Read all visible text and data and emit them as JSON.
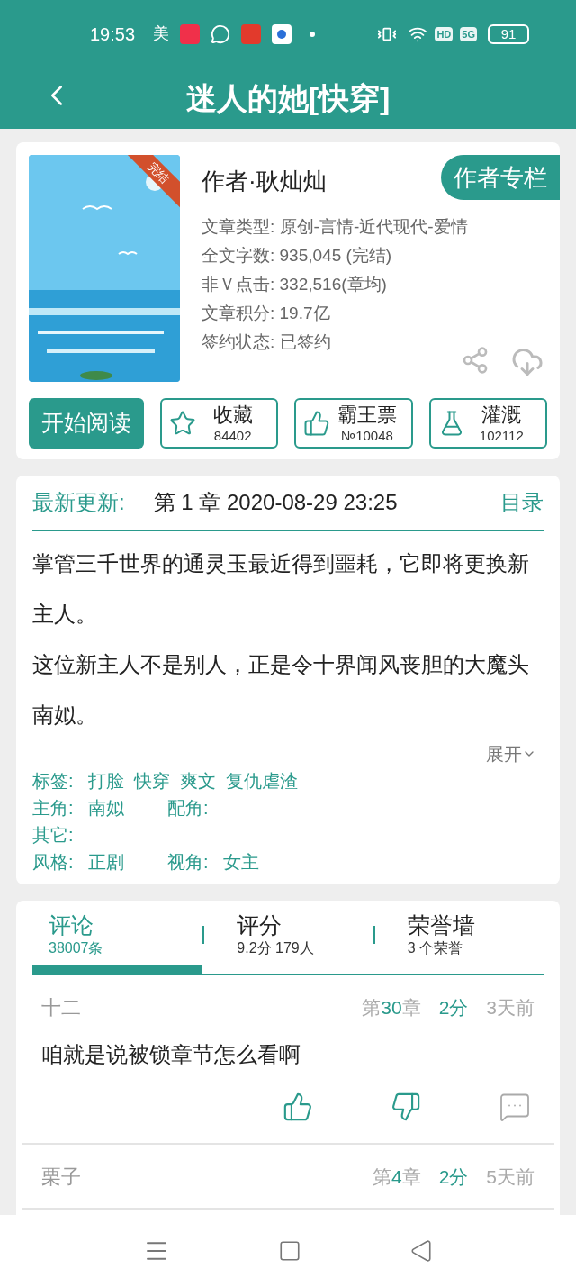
{
  "status_bar": {
    "time": "19:53",
    "notification": "美",
    "indicators": [
      "HD",
      "5G"
    ],
    "battery": "91"
  },
  "header": {
    "title": "迷人的她[快穿]"
  },
  "book": {
    "badge": "完结",
    "author": "作者·耿灿灿",
    "author_button": "作者专栏",
    "info": [
      "文章类型: 原创-言情-近代现代-爱情",
      "全文字数: 935,045 (完结)",
      "非Ｖ点击: 332,516(章均)",
      "文章积分: 19.7亿",
      "签约状态:  已签约"
    ],
    "read_button": "开始阅读",
    "stats": [
      {
        "kind": "star",
        "label": "收藏",
        "count": "84402"
      },
      {
        "kind": "thumb",
        "label": "霸王票",
        "count": "№10048"
      },
      {
        "kind": "flask",
        "label": "灌溉",
        "count": "102112"
      }
    ]
  },
  "update": {
    "label": "最新更新:",
    "chapter": "第 1 章  2020-08-29 23:25",
    "toc": "目录"
  },
  "intro": {
    "paragraphs": [
      "掌管三千世界的通灵玉最近得到噩耗，它即将更换新主人。",
      "这位新主人不是别人，正是令十界闻风丧胆的大魔头南姒。"
    ],
    "expand": "展开"
  },
  "meta": [
    [
      {
        "label": "标签:",
        "value": "打脸  快穿  爽文  复仇虐渣"
      }
    ],
    [
      {
        "label": "主角:",
        "value": "南姒"
      },
      {
        "label": "配角:"
      }
    ],
    [
      {
        "label": "其它:"
      }
    ],
    [
      {
        "label": "风格:",
        "value": "正剧"
      },
      {
        "label": "视角:",
        "value": "女主"
      }
    ]
  ],
  "tabs": [
    {
      "title": "评论",
      "sub": "38007条",
      "selected": true
    },
    {
      "title": "评分",
      "sub": "9.2分 179人",
      "selected": false
    },
    {
      "title": "荣誉墙",
      "sub": "3 个荣誉",
      "selected": false
    }
  ],
  "comments": [
    {
      "user": "十二",
      "chapter": [
        "第",
        "30",
        "章"
      ],
      "score": "2分",
      "time": "3天前",
      "text": "咱就是说被锁章节怎么看啊",
      "actions": true
    },
    {
      "user": "栗子",
      "chapter": [
        "第",
        "4",
        "章"
      ],
      "score": "2分",
      "time": "5天前",
      "actions": false
    }
  ]
}
